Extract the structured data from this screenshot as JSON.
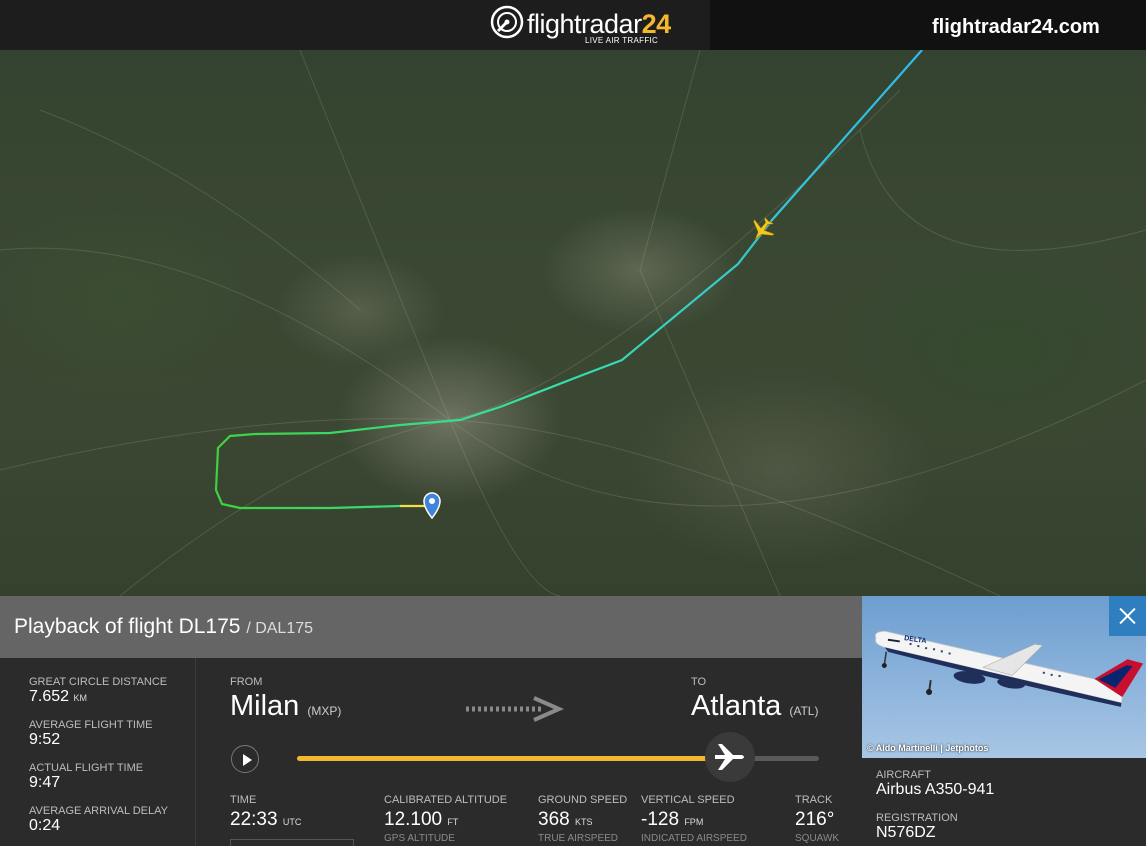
{
  "header": {
    "logo_text": "flightradar",
    "logo_num": "24",
    "logo_tagline": "LIVE AIR TRAFFIC",
    "site_label": "flightradar24.com"
  },
  "map": {
    "track_colors": [
      "#f0e04a",
      "#3fd13f",
      "#38e0a6",
      "#2fb9f2"
    ],
    "pin_color": "#3f84d6",
    "plane_icon_color": "#f3c623"
  },
  "playback": {
    "title": "Playback of flight DL175",
    "subtitle": "/ DAL175",
    "progress_fraction": 0.83
  },
  "stats": [
    {
      "label": "GREAT CIRCLE DISTANCE",
      "value": "7.652",
      "unit": "KM"
    },
    {
      "label": "AVERAGE FLIGHT TIME",
      "value": "9:52",
      "unit": ""
    },
    {
      "label": "ACTUAL FLIGHT TIME",
      "value": "9:47",
      "unit": ""
    },
    {
      "label": "AVERAGE ARRIVAL DELAY",
      "value": "0:24",
      "unit": ""
    }
  ],
  "route": {
    "from_label": "FROM",
    "from_city": "Milan",
    "from_code": "(MXP)",
    "to_label": "TO",
    "to_city": "Atlanta",
    "to_code": "(ATL)"
  },
  "metrics": [
    {
      "label": "TIME",
      "value": "22:33",
      "unit": "UTC",
      "sublabel": ""
    },
    {
      "label": "CALIBRATED ALTITUDE",
      "value": "12.100",
      "unit": "FT",
      "sublabel": "GPS ALTITUDE"
    },
    {
      "label": "GROUND SPEED",
      "value": "368",
      "unit": "KTS",
      "sublabel": "TRUE AIRSPEED"
    },
    {
      "label": "VERTICAL SPEED",
      "value": "-128",
      "unit": "FPM",
      "sublabel": "INDICATED AIRSPEED"
    },
    {
      "label": "TRACK",
      "value": "216°",
      "unit": "",
      "sublabel": "SQUAWK"
    }
  ],
  "aircraft": {
    "photo_credit": "© Aldo Martinelli | Jetphotos",
    "livery_text": "DELTA",
    "aircraft_label": "AIRCRAFT",
    "aircraft_value": "Airbus A350-941",
    "registration_label": "REGISTRATION",
    "registration_value": "N576DZ"
  }
}
